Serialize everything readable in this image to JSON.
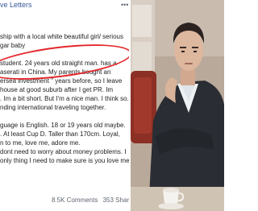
{
  "post": {
    "author": "ve Letters",
    "lines_intro": [
      "ship with a local white beautiful girl/ serious",
      "gar baby"
    ],
    "lines_main": [
      "student. 24 years old straight man. has a",
      "aserati in China. My parents bought an",
      "ersea investment \" years before, so I leave",
      "house at good suburb after I get PR. Im",
      ". Im a bit short. But I'm a nice man. I think so.",
      "nding international traveling together."
    ],
    "lines_more": [
      "guage is English. 18 or 19 years old maybe.",
      ". At least Cup D. Taller than 170cm. Loyal,",
      "n to me, love me, adore me.",
      "dont need to worry about money problems. I",
      "only thing I need to make sure is you love me"
    ],
    "comments": "8.5K Comments",
    "shares": "353 Shares"
  },
  "colors": {
    "author": "#385898",
    "highlight_oval": "#e3272c"
  }
}
